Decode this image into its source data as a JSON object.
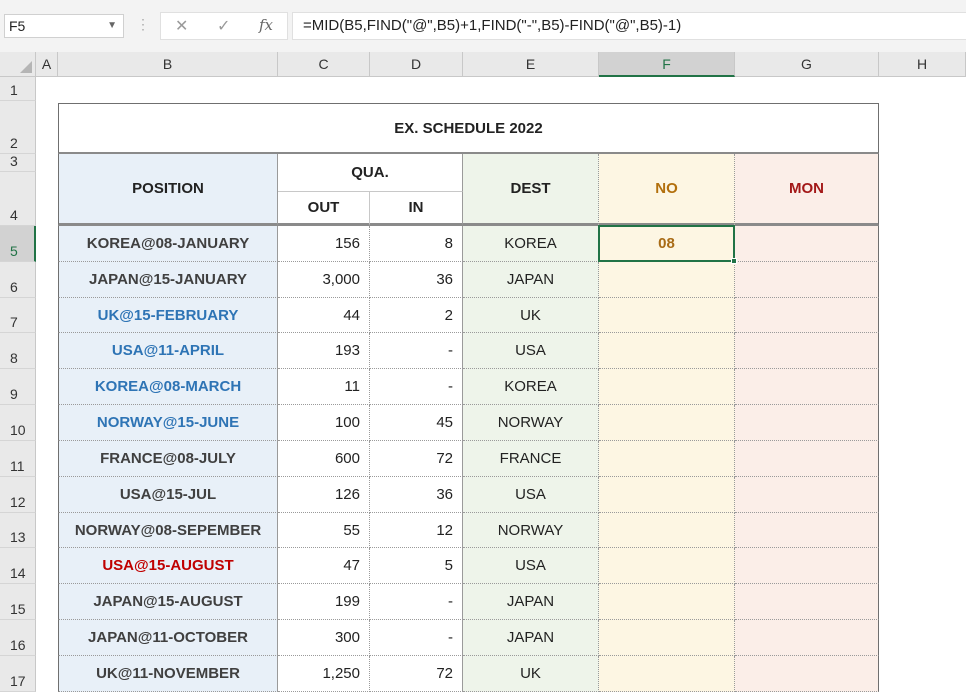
{
  "formula_bar": {
    "cell_ref": "F5",
    "formula": "=MID(B5,FIND(\"@\",B5)+1,FIND(\"-\",B5)-FIND(\"@\",B5)-1)",
    "cancel_icon": "close-icon",
    "enter_icon": "check-icon",
    "fx_label": "fx"
  },
  "columns": [
    "A",
    "B",
    "C",
    "D",
    "E",
    "F",
    "G",
    "H"
  ],
  "selected_column": "F",
  "rows": [
    "1",
    "2",
    "3",
    "4",
    "5",
    "6",
    "7",
    "8",
    "9",
    "10",
    "11",
    "12",
    "13",
    "14",
    "15",
    "16",
    "17"
  ],
  "selected_row": "5",
  "table": {
    "title": "EX. SCHEDULE 2022",
    "header": {
      "position": "POSITION",
      "qua": "QUA.",
      "out": "OUT",
      "in": "IN",
      "dest": "DEST",
      "no": "NO",
      "mon": "MON"
    },
    "colors": {
      "position_bg": "#e8f0f8",
      "dest_bg": "#eef4ea",
      "no_bg": "#fdf6e3",
      "mon_bg": "#fbeee8",
      "no_header_text": "#b26f0c",
      "mon_header_text": "#a31818",
      "blue_text": "#2e74b5",
      "red_text": "#c00000",
      "selection": "#217346"
    },
    "data": [
      {
        "position": "KOREA@08-JANUARY",
        "out": "156",
        "in": "8",
        "dest": "KOREA",
        "no": "08",
        "mon": "",
        "color": "default"
      },
      {
        "position": "JAPAN@15-JANUARY",
        "out": "3,000",
        "in": "36",
        "dest": "JAPAN",
        "no": "",
        "mon": "",
        "color": "default"
      },
      {
        "position": "UK@15-FEBRUARY",
        "out": "44",
        "in": "2",
        "dest": "UK",
        "no": "",
        "mon": "",
        "color": "blue"
      },
      {
        "position": "USA@11-APRIL",
        "out": "193",
        "in": "-",
        "dest": "USA",
        "no": "",
        "mon": "",
        "color": "blue"
      },
      {
        "position": "KOREA@08-MARCH",
        "out": "11",
        "in": "-",
        "dest": "KOREA",
        "no": "",
        "mon": "",
        "color": "blue"
      },
      {
        "position": "NORWAY@15-JUNE",
        "out": "100",
        "in": "45",
        "dest": "NORWAY",
        "no": "",
        "mon": "",
        "color": "blue"
      },
      {
        "position": "FRANCE@08-JULY",
        "out": "600",
        "in": "72",
        "dest": "FRANCE",
        "no": "",
        "mon": "",
        "color": "default"
      },
      {
        "position": "USA@15-JUL",
        "out": "126",
        "in": "36",
        "dest": "USA",
        "no": "",
        "mon": "",
        "color": "default"
      },
      {
        "position": "NORWAY@08-SEPEMBER",
        "out": "55",
        "in": "12",
        "dest": "NORWAY",
        "no": "",
        "mon": "",
        "color": "default"
      },
      {
        "position": "USA@15-AUGUST",
        "out": "47",
        "in": "5",
        "dest": "USA",
        "no": "",
        "mon": "",
        "color": "red"
      },
      {
        "position": "JAPAN@15-AUGUST",
        "out": "199",
        "in": "-",
        "dest": "JAPAN",
        "no": "",
        "mon": "",
        "color": "default"
      },
      {
        "position": "JAPAN@11-OCTOBER",
        "out": "300",
        "in": "-",
        "dest": "JAPAN",
        "no": "",
        "mon": "",
        "color": "default"
      },
      {
        "position": "UK@11-NOVEMBER",
        "out": "1,250",
        "in": "72",
        "dest": "UK",
        "no": "",
        "mon": "",
        "color": "default"
      }
    ]
  }
}
